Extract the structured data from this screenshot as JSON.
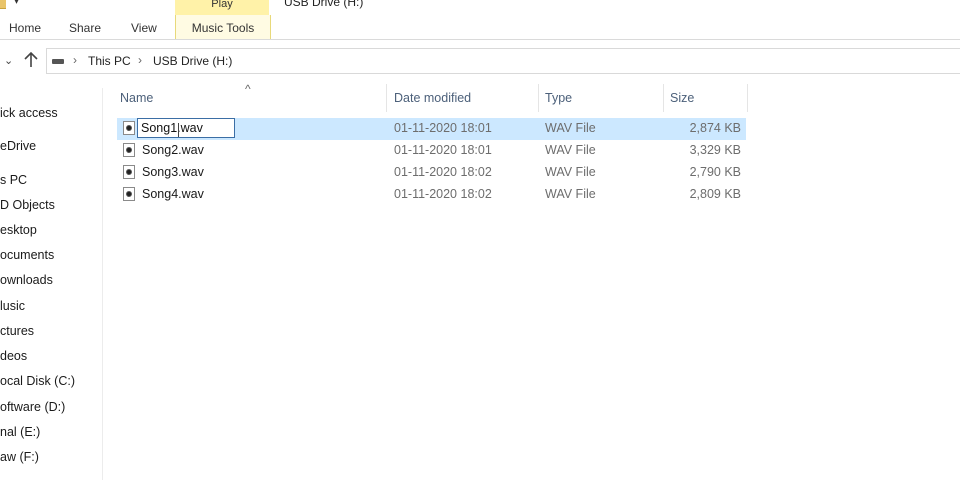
{
  "ribbon": {
    "contextual_tab_group": "Play",
    "window_title": "USB Drive (H:)",
    "tabs": [
      {
        "label": "Home"
      },
      {
        "label": "Share"
      },
      {
        "label": "View"
      },
      {
        "label": "Music Tools"
      }
    ],
    "contextual_color": "#fff2a8"
  },
  "address_bar": {
    "crumbs": [
      "This PC",
      "USB Drive (H:)"
    ]
  },
  "nav_pane": {
    "items": [
      {
        "label": "ick access"
      },
      {
        "label": "eDrive"
      },
      {
        "label": "s PC"
      },
      {
        "label": "D Objects"
      },
      {
        "label": "esktop"
      },
      {
        "label": "ocuments"
      },
      {
        "label": "ownloads"
      },
      {
        "label": "lusic"
      },
      {
        "label": "ctures"
      },
      {
        "label": "deos"
      },
      {
        "label": "ocal Disk (C:)"
      },
      {
        "label": "oftware (D:)"
      },
      {
        "label": "nal (E:)"
      },
      {
        "label": "aw (F:)"
      }
    ]
  },
  "file_list": {
    "columns": [
      "Name",
      "Date modified",
      "Type",
      "Size"
    ],
    "rename_value": "Song1.wav",
    "selection_color": "#cce8ff",
    "rows": [
      {
        "name": "Song1.wav",
        "date": "01-11-2020 18:01",
        "type": "WAV File",
        "size": "2,874 KB",
        "selected": true
      },
      {
        "name": "Song2.wav",
        "date": "01-11-2020 18:01",
        "type": "WAV File",
        "size": "3,329 KB",
        "selected": false
      },
      {
        "name": "Song3.wav",
        "date": "01-11-2020 18:02",
        "type": "WAV File",
        "size": "2,790 KB",
        "selected": false
      },
      {
        "name": "Song4.wav",
        "date": "01-11-2020 18:02",
        "type": "WAV File",
        "size": "2,809 KB",
        "selected": false
      }
    ]
  }
}
